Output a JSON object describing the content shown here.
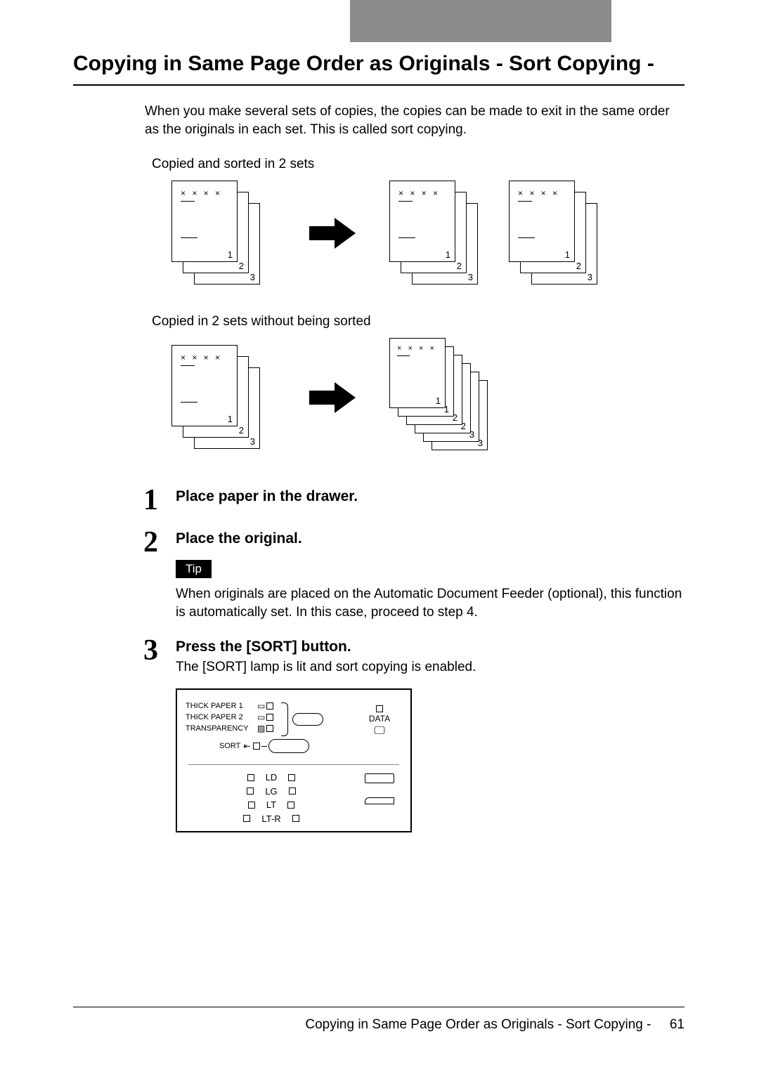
{
  "header": {
    "tab": ""
  },
  "title": "Copying in Same Page Order as Originals - Sort Copying -",
  "intro": "When you make several sets of copies, the copies can be made to exit in the same order as the originals in each set. This is called sort copying.",
  "caption_sorted": "Copied and sorted in 2 sets",
  "caption_unsorted": "Copied in 2 sets without being sorted",
  "pages": {
    "marks": "× × × ×",
    "n1": "1",
    "n2": "2",
    "n3": "3"
  },
  "steps": [
    {
      "num": "1",
      "heading": "Place paper in the drawer."
    },
    {
      "num": "2",
      "heading": "Place the original.",
      "tip": "Tip",
      "tip_text": "When originals are placed on the Automatic Document Feeder (optional), this function is automatically set. In this case, proceed to step 4."
    },
    {
      "num": "3",
      "heading": "Press the [SORT] button.",
      "sub": "The [SORT] lamp is lit and sort copying is enabled."
    }
  ],
  "panel": {
    "thick1": "THICK PAPER 1",
    "thick2": "THICK PAPER 2",
    "transparency": "TRANSPARENCY",
    "sort": "SORT",
    "data": "DATA",
    "sizes": [
      "LD",
      "LG",
      "LT",
      "LT-R"
    ]
  },
  "footer": {
    "text": "Copying in Same Page Order as Originals - Sort Copying -",
    "page": "61"
  }
}
